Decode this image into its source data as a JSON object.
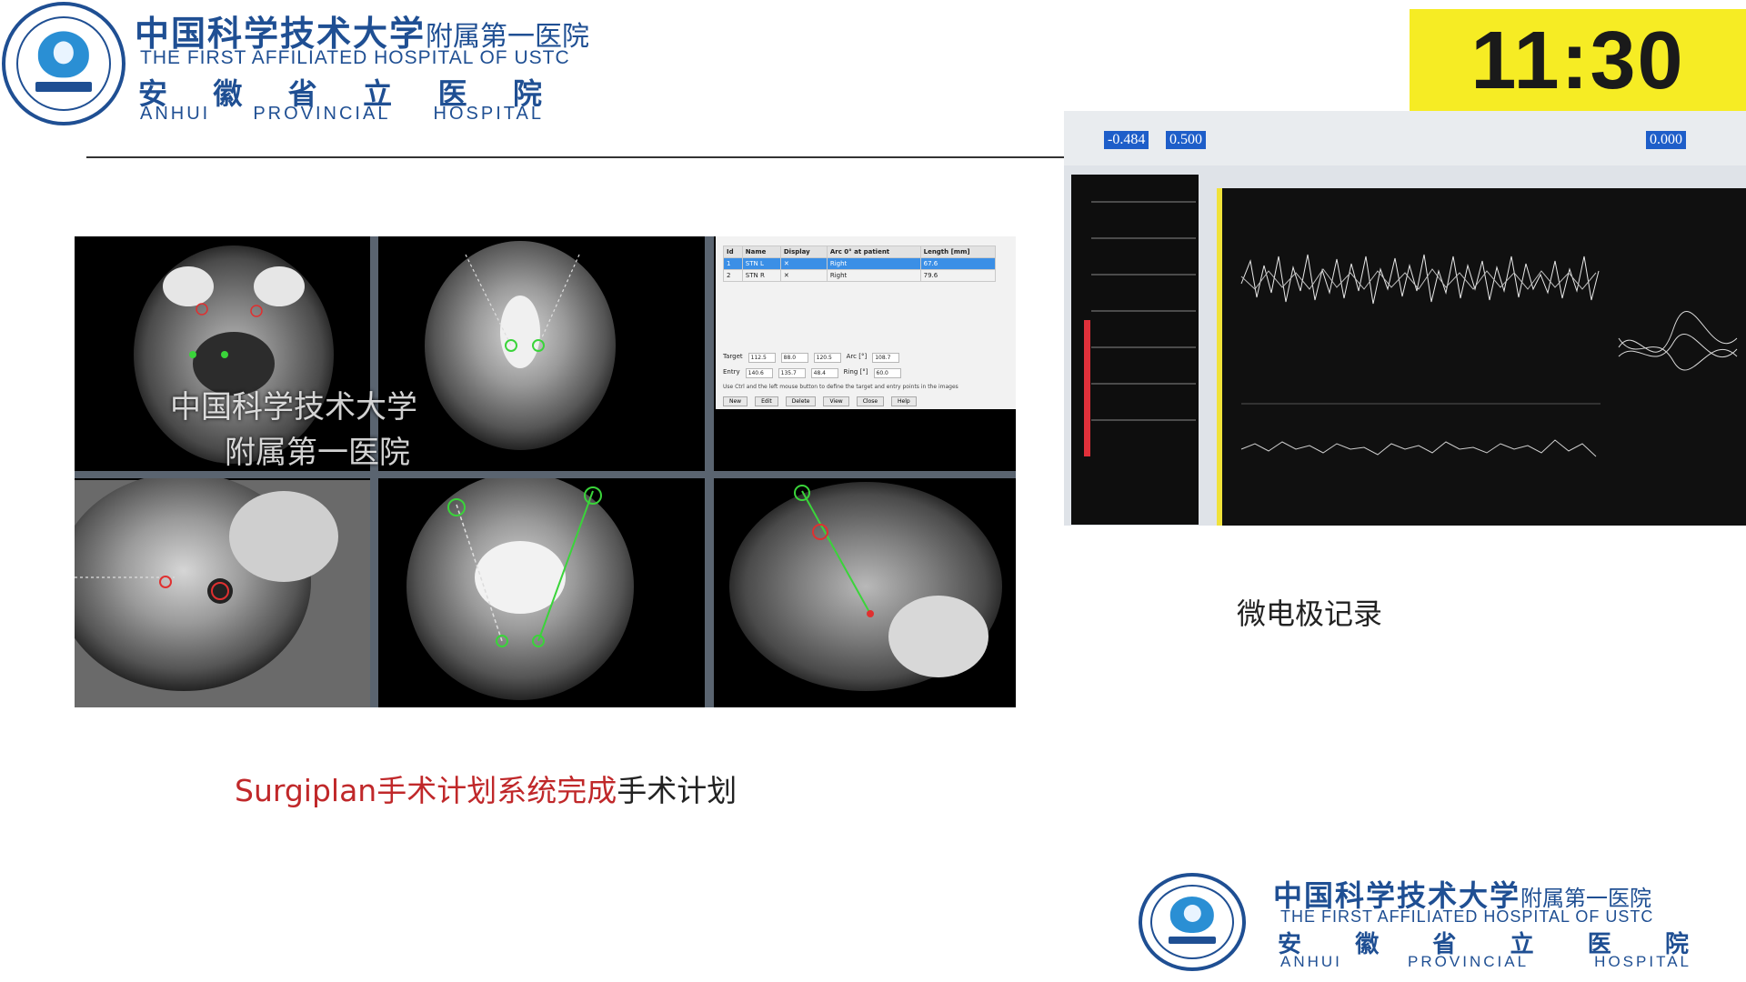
{
  "header": {
    "title_cn": "中国科学技术大学",
    "subtitle_cn": "附属第一医院",
    "title_en": "THE FIRST AFFILIATED HOSPITAL OF USTC",
    "province_cn": [
      "安",
      "徽",
      "省",
      "立",
      "医",
      "院"
    ],
    "province_en": [
      "ANHUI",
      "PROVINCIAL",
      "HOSPITAL"
    ]
  },
  "clock": {
    "time": "11:30"
  },
  "watermark": {
    "line1": "中国科学技术大学",
    "line2": "附属第一医院"
  },
  "plan_table": {
    "columns": [
      "Id",
      "Name",
      "Display",
      "Arc 0° at patient",
      "Length [mm]"
    ],
    "rows": [
      [
        "1",
        "STN L",
        "✕",
        "Right",
        "67.6"
      ],
      [
        "2",
        "STN R",
        "✕",
        "Right",
        "79.6"
      ]
    ],
    "target": [
      "Target",
      "112.5",
      "88.0",
      "120.5",
      "Arc [°]",
      "108.7"
    ],
    "entry": [
      "Entry",
      "140.6",
      "135.7",
      "48.4",
      "Ring [°]",
      "60.0"
    ],
    "note": "Use Ctrl and the left mouse button to define the target and entry points in the images",
    "buttons": [
      "New",
      "Edit",
      "Delete",
      "View",
      "Close",
      "Help"
    ]
  },
  "recording": {
    "readout_1": "-0.484",
    "readout_2": "0.500",
    "readout_3": "0.000"
  },
  "captions": {
    "left_red": "Surgiplan手术计划系统完成",
    "left_black": "手术计划",
    "right": "微电极记录"
  },
  "colors": {
    "brand_blue": "#1f4f93",
    "clock_yellow": "#f6ec24",
    "caption_red": "#c0282a",
    "trajectory_green": "#3ad43a"
  }
}
